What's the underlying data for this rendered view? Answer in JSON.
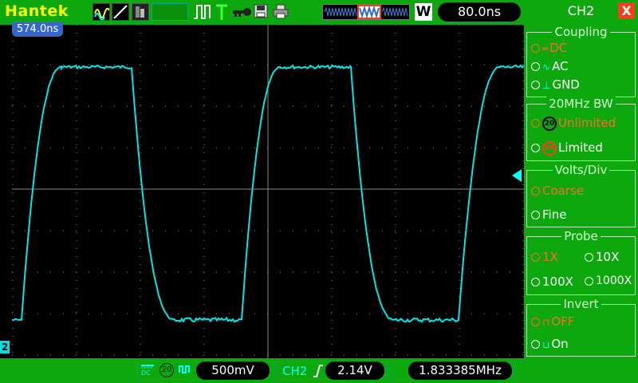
{
  "topbar": {
    "brand": "Hantek",
    "timebase": "80.0ns",
    "w_label": "W",
    "icons": [
      "wave-icon",
      "line-icon",
      "persistence-icon",
      "pulse-icon",
      "trigger-icon",
      "key-icon",
      "save-icon",
      "print-icon",
      "memory-icon"
    ]
  },
  "scope": {
    "trigger_pos": "574.0ns",
    "channel_marker": "2"
  },
  "bottombar": {
    "volts_div": "500mV",
    "trigger_channel": "CH2",
    "trigger_level": "2.14V",
    "frequency": "1.833385MHz",
    "coupling_glyph": "DC",
    "bw_glyph": "20"
  },
  "menu": {
    "title": "CH2",
    "close": "X",
    "coupling": {
      "title": "Coupling",
      "options": [
        "DC",
        "AC",
        "GND"
      ],
      "selected": "DC"
    },
    "bw": {
      "title": "20MHz BW",
      "options": [
        "Unlimited",
        "Limited"
      ],
      "selected": "Unlimited"
    },
    "volts": {
      "title": "Volts/Div",
      "options": [
        "Coarse",
        "Fine"
      ],
      "selected": "Coarse"
    },
    "probe": {
      "title": "Probe",
      "options": [
        "1X",
        "10X",
        "100X",
        "1000X"
      ],
      "selected": "1X"
    },
    "invert": {
      "title": "Invert",
      "options": [
        "OFF",
        "On"
      ],
      "selected": "OFF"
    }
  },
  "colors": {
    "frame": "#0da80d",
    "trace": "#00e5e5",
    "accent": "#ff6a2a",
    "brand": "#ffff00"
  }
}
